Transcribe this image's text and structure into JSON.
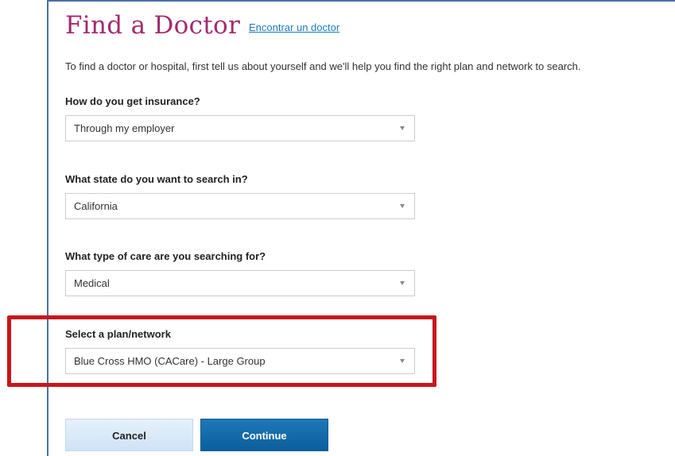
{
  "header": {
    "title": "Find a Doctor",
    "language_link": "Encontrar un doctor"
  },
  "intro_text": "To find a doctor or hospital, first tell us about yourself and we'll help you find the right plan and network to search.",
  "form": {
    "insurance": {
      "label": "How do you get insurance?",
      "value": "Through my employer"
    },
    "state": {
      "label": "What state do you want to search in?",
      "value": "California"
    },
    "care_type": {
      "label": "What type of care are you searching for?",
      "value": "Medical"
    },
    "plan": {
      "label": "Select a plan/network",
      "value": "Blue Cross HMO (CACare) - Large Group"
    }
  },
  "buttons": {
    "cancel": "Cancel",
    "continue": "Continue"
  },
  "colors": {
    "title": "#a32a6e",
    "link": "#1a7bb6",
    "highlight": "#c8161d",
    "continue_button": "#0c5e9a"
  }
}
